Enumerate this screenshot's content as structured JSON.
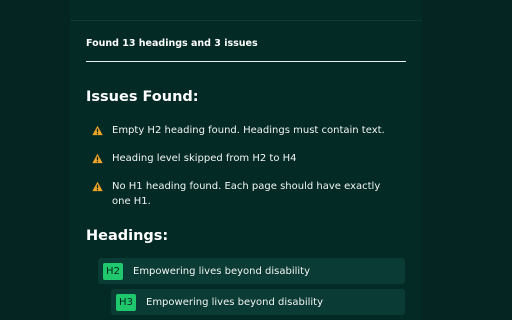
{
  "summary": {
    "text": "Found 13 headings and 3 issues"
  },
  "issues_section": {
    "title": "Issues Found:",
    "icon": "warning-triangle-icon",
    "warning_color": "#f2a626",
    "items": [
      {
        "text": "Empty H2 heading found. Headings must contain text."
      },
      {
        "text": "Heading level skipped from H2 to H4"
      },
      {
        "text": "No H1 heading found. Each page should have exactly one H1."
      }
    ]
  },
  "headings_section": {
    "title": "Headings:",
    "badge_color": "#1fc86d",
    "items": [
      {
        "level": "H2",
        "text": "Empowering lives beyond disability"
      },
      {
        "level": "H3",
        "text": "Empowering lives beyond disability"
      }
    ]
  }
}
